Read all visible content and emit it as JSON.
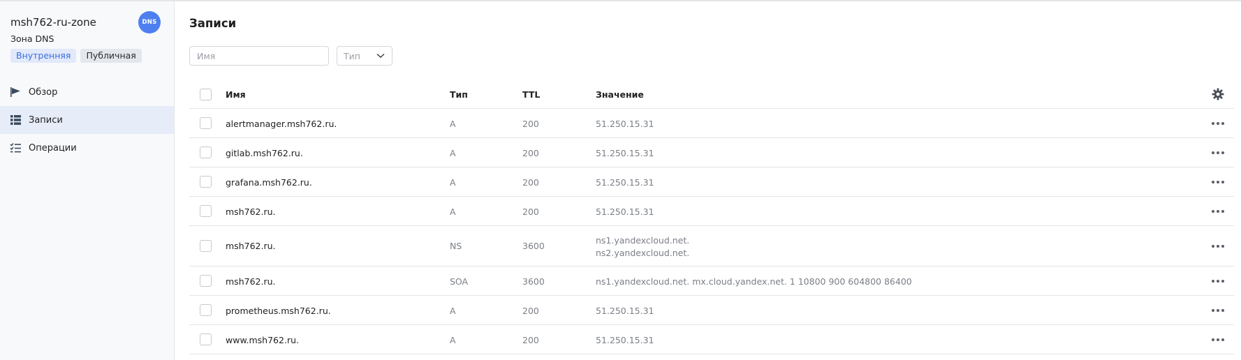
{
  "sidebar": {
    "zone_name": "msh762-ru-zone",
    "zone_subtitle": "Зона DNS",
    "badge": "DNS",
    "tags": [
      "Внутренняя",
      "Публичная"
    ],
    "nav": [
      {
        "label": "Обзор",
        "icon": "flag-icon"
      },
      {
        "label": "Записи",
        "icon": "list-icon",
        "active": true
      },
      {
        "label": "Операции",
        "icon": "checklist-icon"
      }
    ]
  },
  "main": {
    "title": "Записи",
    "filters": {
      "name_placeholder": "Имя",
      "type_label": "Тип"
    },
    "table": {
      "columns": {
        "name": "Имя",
        "type": "Тип",
        "ttl": "TTL",
        "value": "Значение"
      },
      "rows": [
        {
          "name": "alertmanager.msh762.ru.",
          "type": "A",
          "ttl": "200",
          "value": [
            "51.250.15.31"
          ]
        },
        {
          "name": "gitlab.msh762.ru.",
          "type": "A",
          "ttl": "200",
          "value": [
            "51.250.15.31"
          ]
        },
        {
          "name": "grafana.msh762.ru.",
          "type": "A",
          "ttl": "200",
          "value": [
            "51.250.15.31"
          ]
        },
        {
          "name": "msh762.ru.",
          "type": "A",
          "ttl": "200",
          "value": [
            "51.250.15.31"
          ]
        },
        {
          "name": "msh762.ru.",
          "type": "NS",
          "ttl": "3600",
          "value": [
            "ns1.yandexcloud.net.",
            "ns2.yandexcloud.net."
          ]
        },
        {
          "name": "msh762.ru.",
          "type": "SOA",
          "ttl": "3600",
          "value": [
            "ns1.yandexcloud.net. mx.cloud.yandex.net. 1 10800 900 604800 86400"
          ]
        },
        {
          "name": "prometheus.msh762.ru.",
          "type": "A",
          "ttl": "200",
          "value": [
            "51.250.15.31"
          ]
        },
        {
          "name": "www.msh762.ru.",
          "type": "A",
          "ttl": "200",
          "value": [
            "51.250.15.31"
          ]
        }
      ]
    }
  },
  "colors": {
    "accent": "#4e7ff0",
    "active_nav_bg": "#e6edf9",
    "sidebar_bg": "#f8f9fb",
    "muted_text": "#7a7e86"
  }
}
